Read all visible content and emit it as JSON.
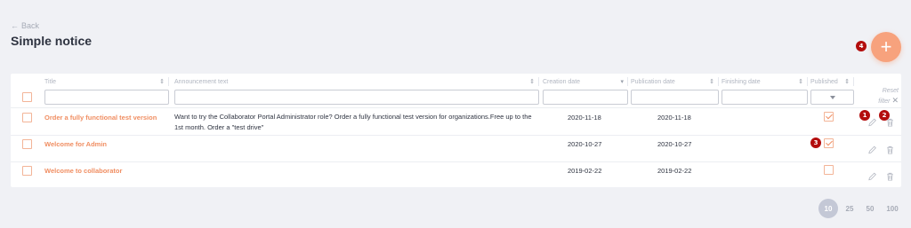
{
  "header": {
    "back_label": "Back",
    "page_title": "Simple notice",
    "add_label": "+"
  },
  "table": {
    "columns": [
      {
        "label": "Title"
      },
      {
        "label": "Announcement text"
      },
      {
        "label": "Creation date"
      },
      {
        "label": "Publication date"
      },
      {
        "label": "Finishing date"
      },
      {
        "label": "Published"
      }
    ],
    "reset_label": "Reset filter",
    "rows": [
      {
        "title": "Order a fully functional test version",
        "text": "Want to try the Collaborator Portal Administrator role? Order a fully functional test version for organizations.Free up to the 1st month. Order a \"test drive\"",
        "created": "2020-11-18",
        "published_date": "2020-11-18",
        "finishing": "",
        "published": true
      },
      {
        "title": "Welcome for Admin",
        "text": "",
        "created": "2020-10-27",
        "published_date": "2020-10-27",
        "finishing": "",
        "published": true
      },
      {
        "title": "Welcome to collaborator",
        "text": "",
        "created": "2019-02-22",
        "published_date": "2019-02-22",
        "finishing": "",
        "published": false
      }
    ]
  },
  "markers": [
    "1",
    "2",
    "3",
    "4"
  ],
  "pagination": {
    "sizes": [
      "10",
      "25",
      "50",
      "100"
    ],
    "active": "10"
  },
  "colors": {
    "accent": "#f08e62",
    "fab": "#f7a27d",
    "marker": "#b30d0d",
    "background": "#f0f1f5"
  },
  "icons": {
    "back": "arrow-left-icon",
    "edit": "pencil-icon",
    "delete": "trash-icon",
    "add": "plus-icon"
  }
}
